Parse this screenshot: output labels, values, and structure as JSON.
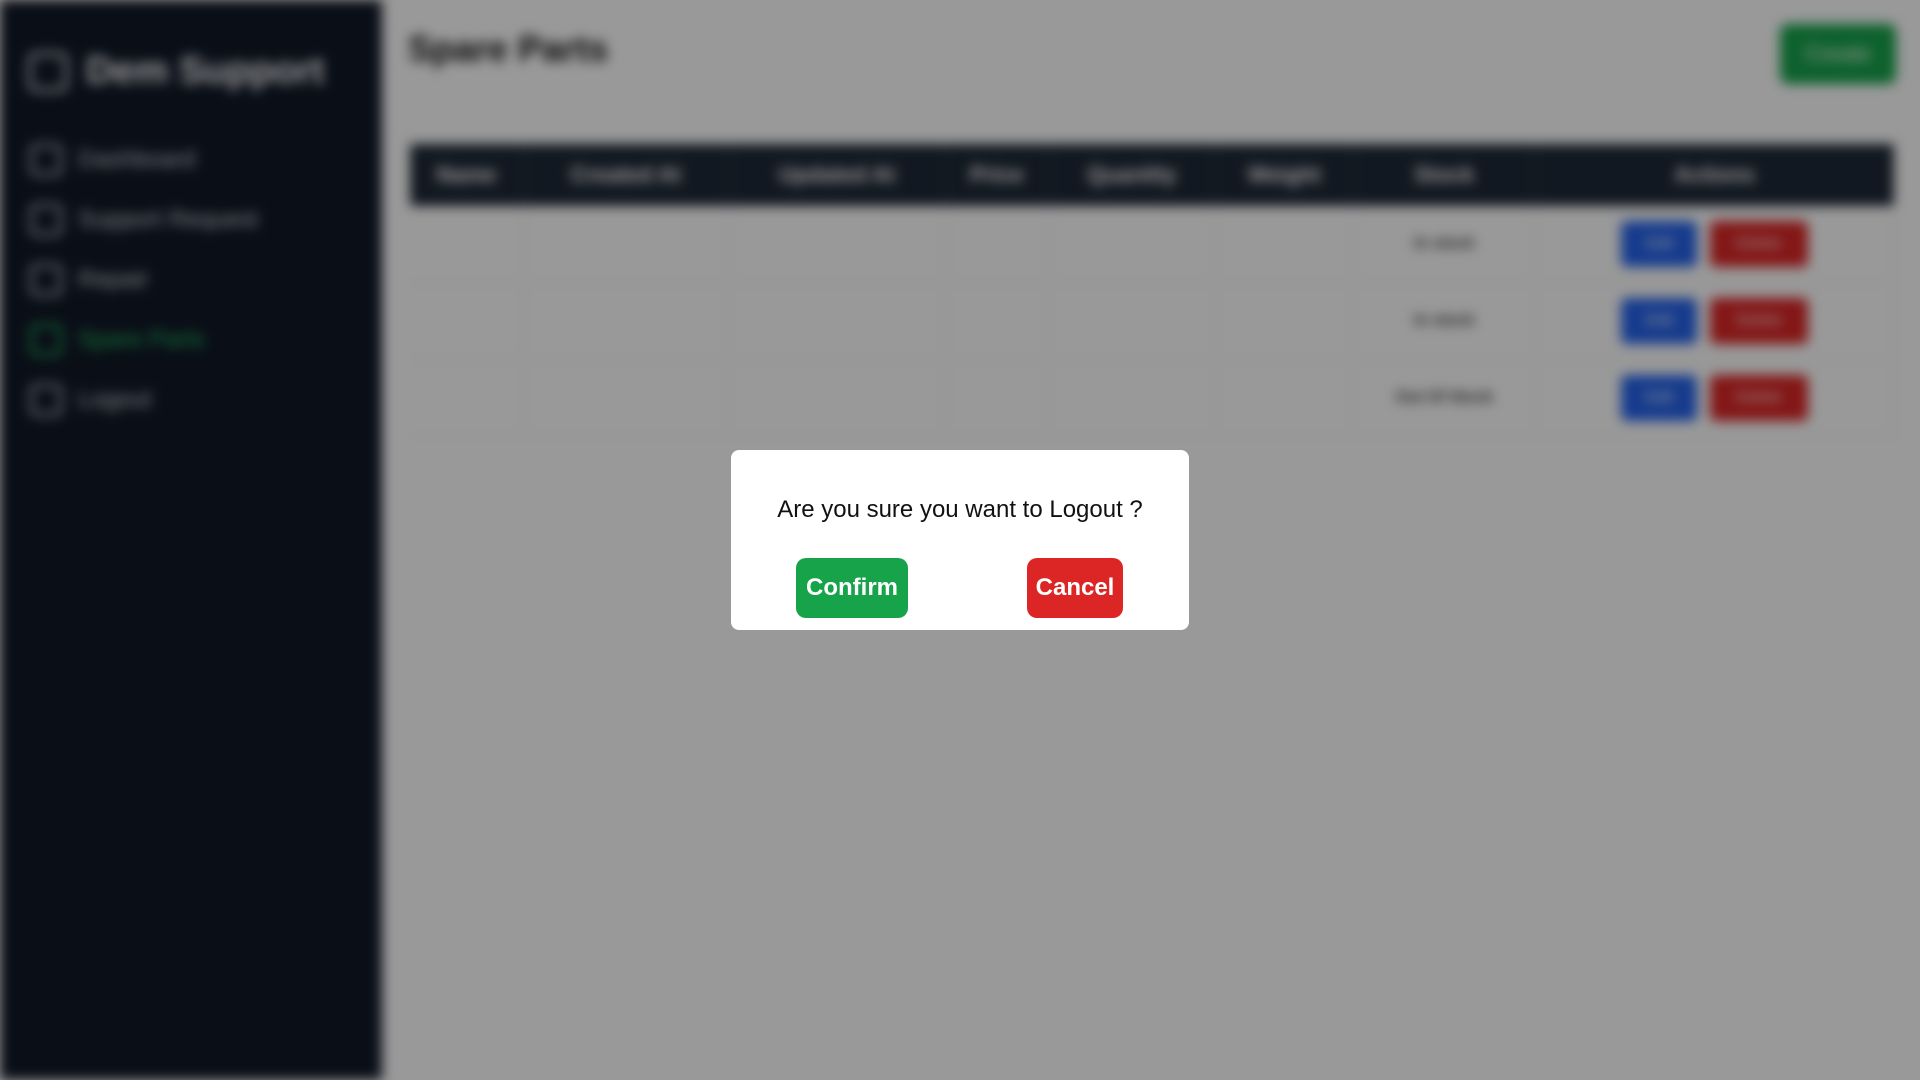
{
  "sidebar": {
    "brand": "Dem Support",
    "items": [
      {
        "label": "Dashboard",
        "icon": "dashboard-icon"
      },
      {
        "label": "Support Request",
        "icon": "headset-icon"
      },
      {
        "label": "Repair",
        "icon": "wrench-icon"
      },
      {
        "label": "Spare Parts",
        "icon": "gear-icon",
        "active": true
      },
      {
        "label": "Logout",
        "icon": "logout-icon"
      }
    ]
  },
  "main": {
    "title": "Spare Parts",
    "create_label": "Create",
    "table": {
      "headers": [
        "Name",
        "Created At",
        "Updated At",
        "Price",
        "Quantity",
        "Weight",
        "Stock",
        "Actions"
      ],
      "rows": [
        [
          "",
          "",
          "",
          "",
          "",
          "",
          "In stock",
          ""
        ],
        [
          "",
          "",
          "",
          "",
          "",
          "",
          "In stock",
          ""
        ],
        [
          "",
          "",
          "",
          "",
          "",
          "",
          "Out Of Stock",
          ""
        ]
      ],
      "edit_label": "Edit",
      "delete_label": "Delete"
    }
  },
  "modal": {
    "message": "Are you sure you want to Logout ?",
    "confirm_label": "Confirm",
    "cancel_label": "Cancel"
  },
  "colors": {
    "sidebar_bg": "#111827",
    "confirm": "#16a34a",
    "cancel": "#dc2626",
    "edit": "#2563eb"
  }
}
